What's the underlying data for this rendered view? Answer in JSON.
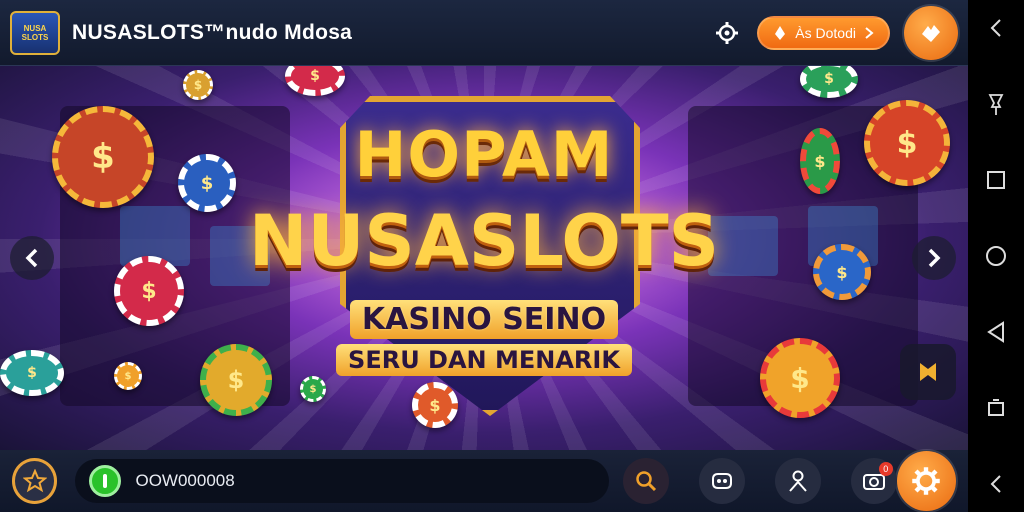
{
  "header": {
    "logo_text": "NUSA SLOTS",
    "title": "NUSASLOTS™nudo Mdosa",
    "balance_label": "Às Dotodi"
  },
  "hero": {
    "title_line1": "HOPAM",
    "title_line2": "NUSASLOTS",
    "subtitle_line1": "KASINO SEINO",
    "subtitle_line2": "SERU DAN MENARIK"
  },
  "bottom": {
    "code_value": "OOW000008",
    "notif_count": "0"
  },
  "colors": {
    "accent_orange": "#f07818",
    "gold": "#ffd03a",
    "green": "#2ac22a"
  }
}
